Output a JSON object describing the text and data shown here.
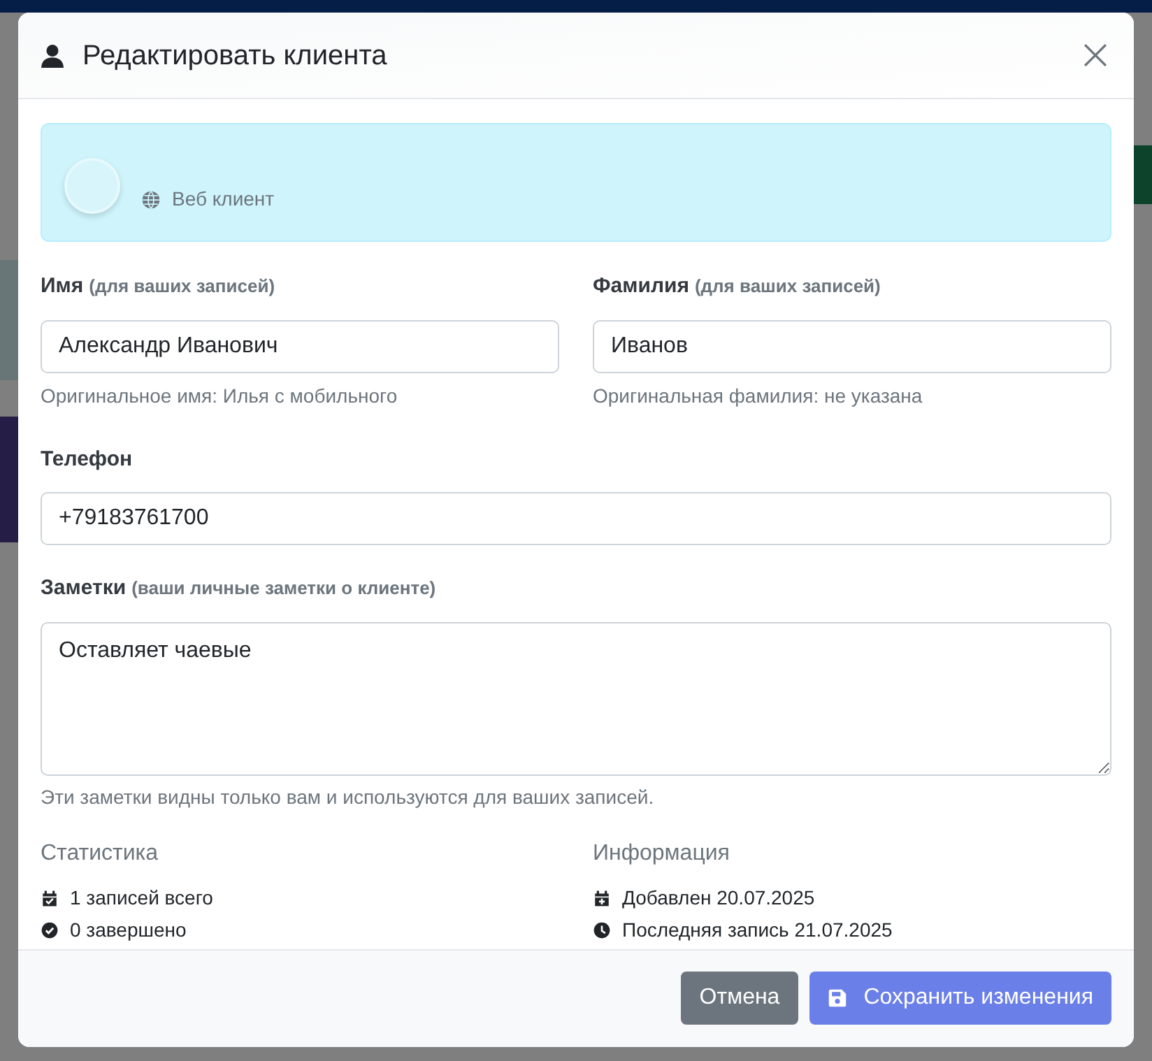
{
  "modal": {
    "title": "Редактировать клиента",
    "source": "Веб клиент",
    "first_name": {
      "label": "Имя",
      "hint": "(для ваших записей)",
      "value": "Александр Иванович",
      "help": "Оригинальное имя: Илья с мобильного"
    },
    "last_name": {
      "label": "Фамилия",
      "hint": "(для ваших записей)",
      "value": "Иванов",
      "help": "Оригинальная фамилия: не указана"
    },
    "phone": {
      "label": "Телефон",
      "value": "+79183761700"
    },
    "notes": {
      "label": "Заметки",
      "hint": "(ваши личные заметки о клиенте)",
      "value": "Оставляет чаевые",
      "help": "Эти заметки видны только вам и используются для ваших записей."
    },
    "statistics": {
      "title": "Статистика",
      "items": [
        {
          "kind": "calendar-check",
          "text": "1 записей всего"
        },
        {
          "kind": "check-circle",
          "text": "0 завершено"
        }
      ]
    },
    "information": {
      "title": "Информация",
      "items": [
        {
          "kind": "calendar-plus",
          "text": "Добавлен 20.07.2025"
        },
        {
          "kind": "clock",
          "text": "Последняя запись 21.07.2025"
        }
      ]
    },
    "buttons": [
      {
        "kind": "cancel",
        "label": "Отмена"
      },
      {
        "kind": "save",
        "label": "Сохранить изменения"
      }
    ]
  }
}
